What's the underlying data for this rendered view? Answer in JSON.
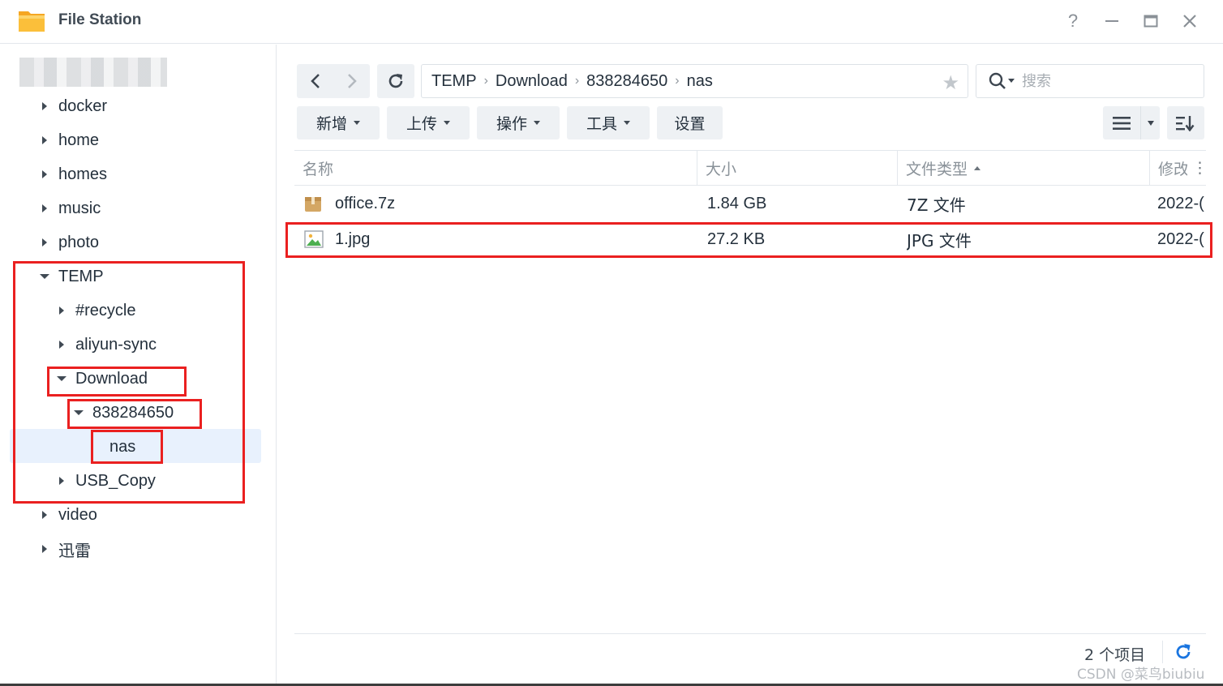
{
  "window": {
    "title": "File Station"
  },
  "sidebar": {
    "items": [
      {
        "label": "docker",
        "state": "collapsed"
      },
      {
        "label": "home",
        "state": "collapsed"
      },
      {
        "label": "homes",
        "state": "collapsed"
      },
      {
        "label": "music",
        "state": "collapsed"
      },
      {
        "label": "photo",
        "state": "collapsed"
      },
      {
        "label": "TEMP",
        "state": "expanded"
      },
      {
        "label": "#recycle",
        "state": "collapsed"
      },
      {
        "label": "aliyun-sync",
        "state": "collapsed"
      },
      {
        "label": "Download",
        "state": "expanded"
      },
      {
        "label": "838284650",
        "state": "expanded"
      },
      {
        "label": "nas",
        "state": "selected"
      },
      {
        "label": "USB_Copy",
        "state": "collapsed"
      },
      {
        "label": "video",
        "state": "collapsed"
      },
      {
        "label": "迅雷",
        "state": "collapsed"
      }
    ]
  },
  "breadcrumb": [
    "TEMP",
    "Download",
    "838284650",
    "nas"
  ],
  "search": {
    "placeholder": "搜索"
  },
  "toolbar": {
    "create": "新增",
    "upload": "上传",
    "action": "操作",
    "tools": "工具",
    "settings": "设置"
  },
  "table": {
    "columns": [
      "名称",
      "大小",
      "文件类型",
      "修改"
    ],
    "sorted_column": "文件类型",
    "rows": [
      {
        "name": "office.7z",
        "size": "1.84 GB",
        "type": "7Z 文件",
        "modified": "2022-(",
        "icon": "archive-icon"
      },
      {
        "name": "1.jpg",
        "size": "27.2 KB",
        "type": "JPG 文件",
        "modified": "2022-(",
        "icon": "image-file-icon"
      }
    ]
  },
  "status": {
    "count": "2 个项目"
  },
  "watermark": "CSDN @菜鸟biubiu",
  "colors": {
    "highlight_box": "#ea2020",
    "selection": "#e8f1fd",
    "accent": "#1a75e0"
  }
}
